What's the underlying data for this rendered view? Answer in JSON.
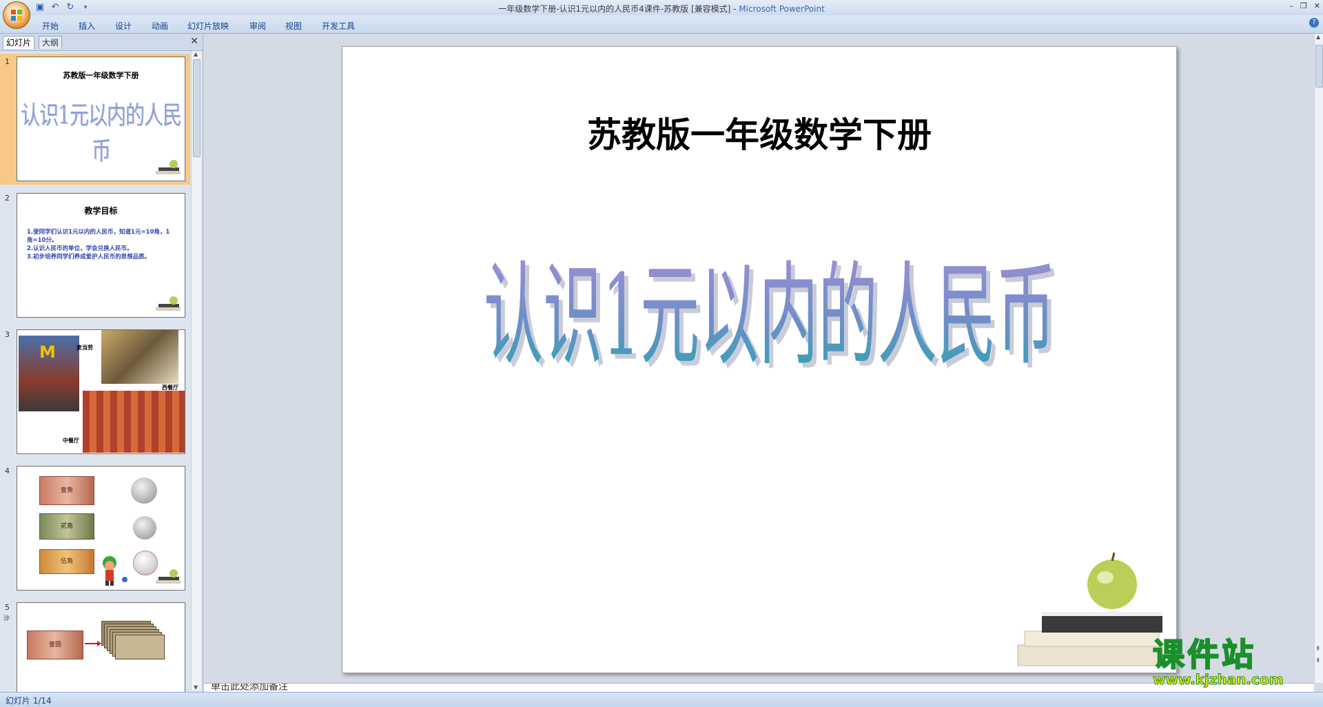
{
  "window": {
    "title": "一年级数学下册-认识1元以内的人民币4课件-苏教版 [兼容模式] - ",
    "app_name": "Microsoft PowerPoint"
  },
  "ribbon": {
    "tabs": [
      "开始",
      "插入",
      "设计",
      "动画",
      "幻灯片放映",
      "审阅",
      "视图",
      "开发工具"
    ]
  },
  "left_pane": {
    "tab_slides": "幻灯片",
    "tab_outline": "大纲",
    "slides": [
      {
        "num": "1",
        "subtitle": "苏教版一年级数学下册",
        "title": "认识1元以内的人民币"
      },
      {
        "num": "2",
        "title": "教学目标",
        "items": [
          "1.使同学们认识1元以内的人民币，知道1元=10角，1角=10分。",
          "2.认识人民币的单位，学会兑换人民币。",
          "3.初步培养同学们养成爱护人民币的思想品质。"
        ]
      },
      {
        "num": "3",
        "labels": [
          "麦当劳",
          "西餐厅",
          "中餐厅"
        ]
      },
      {
        "num": "4",
        "note_labels": [
          "壹角",
          "贰角",
          "伍角"
        ]
      },
      {
        "num": "5",
        "note_label": "壹圆",
        "marker": "沙"
      }
    ]
  },
  "main_slide": {
    "subtitle": "苏教版一年级数学下册",
    "title": "认识1元以内的人民币"
  },
  "notes_placeholder": "单击此处添加备注",
  "status": {
    "slide_counter": "幻灯片 1/14"
  },
  "watermark": {
    "text": "课件站",
    "url": "www.kjzhan.com"
  },
  "colors": {
    "title_fill": "#7e87c6",
    "title_fill_bottom": "#2aa5b6",
    "selected_thumb": "#f7c887",
    "watermark_yellow": "#f6e200",
    "watermark_green": "#1a8f2a"
  }
}
